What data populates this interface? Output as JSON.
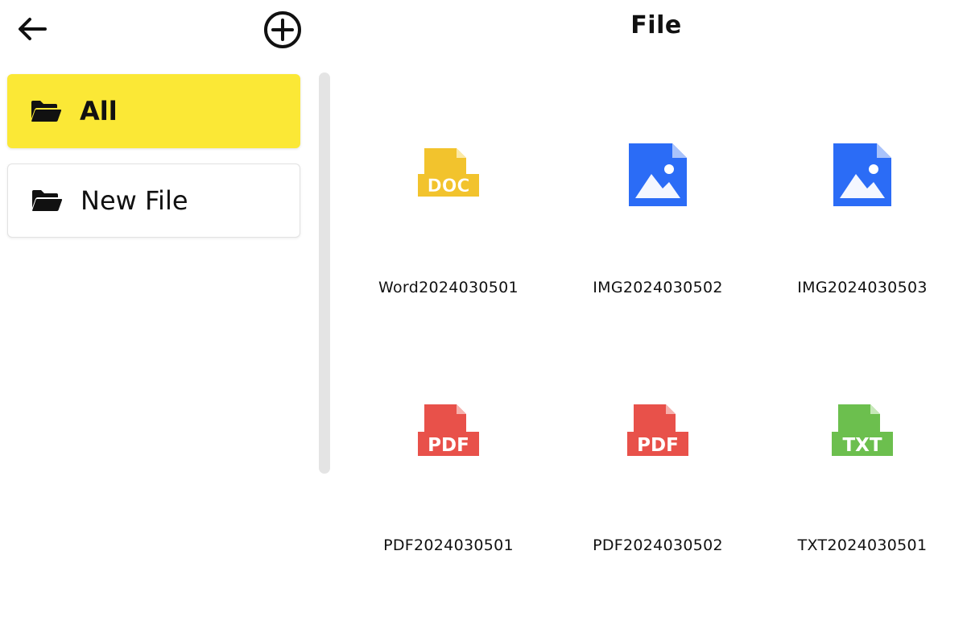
{
  "header": {
    "title": "File",
    "back_icon": "arrow-left-icon",
    "add_icon": "plus-circle-icon"
  },
  "sidebar": {
    "items": [
      {
        "label": "All",
        "icon": "folder-open-icon",
        "selected": true,
        "bg": "#fbe836"
      },
      {
        "label": "New File",
        "icon": "folder-open-icon",
        "selected": false
      }
    ]
  },
  "files": [
    {
      "name": "Word2024030501",
      "type": "DOC",
      "icon": "doc-file-icon",
      "color": "#f2c32d"
    },
    {
      "name": "IMG2024030502",
      "type": "IMG",
      "icon": "image-file-icon",
      "color": "#2b6cf6"
    },
    {
      "name": "IMG2024030503",
      "type": "IMG",
      "icon": "image-file-icon",
      "color": "#2b6cf6"
    },
    {
      "name": "PDF2024030501",
      "type": "PDF",
      "icon": "pdf-file-icon",
      "color": "#e8514a"
    },
    {
      "name": "PDF2024030502",
      "type": "PDF",
      "icon": "pdf-file-icon",
      "color": "#e8514a"
    },
    {
      "name": "TXT2024030501",
      "type": "TXT",
      "icon": "txt-file-icon",
      "color": "#6cbf4e"
    }
  ]
}
